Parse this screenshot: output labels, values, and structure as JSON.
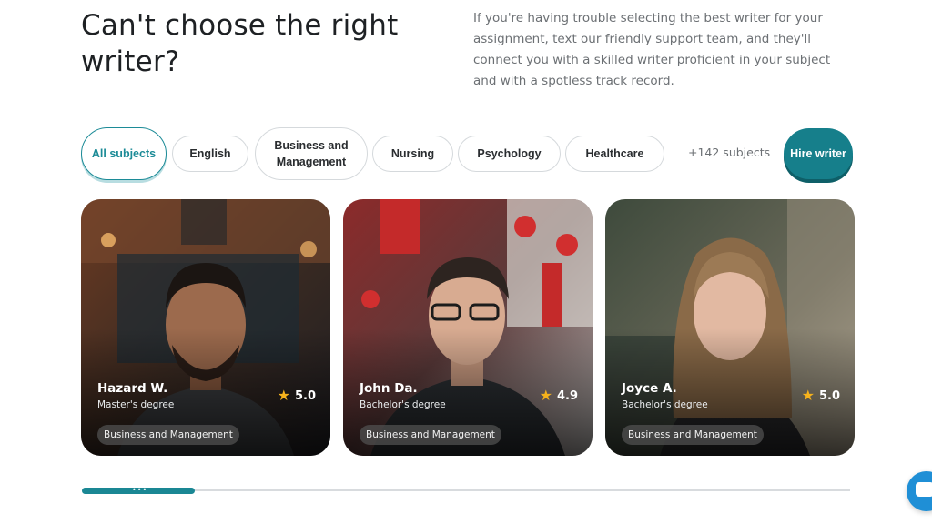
{
  "headline": "Can't choose the right writer?",
  "intro": "If you're having trouble selecting the best writer for your assignment, text our friendly support team, and they'll connect you with a skilled writer proficient in your subject and with a spotless track record.",
  "filters": {
    "chips": [
      {
        "label": "All subjects",
        "active": true
      },
      {
        "label": "English"
      },
      {
        "label": "Business and Management"
      },
      {
        "label": "Nursing"
      },
      {
        "label": "Psychology"
      },
      {
        "label": "Healthcare"
      }
    ],
    "more_label": "+142 subjects",
    "hire_label": "Hire writer"
  },
  "writers": [
    {
      "name": "Hazard W.",
      "degree": "Master's degree",
      "rating": "5.0",
      "subject": "Business and Management",
      "photo_icon": "writer-photo"
    },
    {
      "name": "John Da.",
      "degree": "Bachelor's degree",
      "rating": "4.9",
      "subject": "Business and Management",
      "photo_icon": "writer-photo"
    },
    {
      "name": "Joyce A.",
      "degree": "Bachelor's degree",
      "rating": "5.0",
      "subject": "Business and Management",
      "photo_icon": "writer-photo"
    }
  ],
  "carousel": {
    "progress_fraction": 0.15,
    "grip": "•••"
  },
  "colors": {
    "accent": "#1a8794",
    "star": "#f6b21c",
    "chat": "#1f8fd6"
  }
}
